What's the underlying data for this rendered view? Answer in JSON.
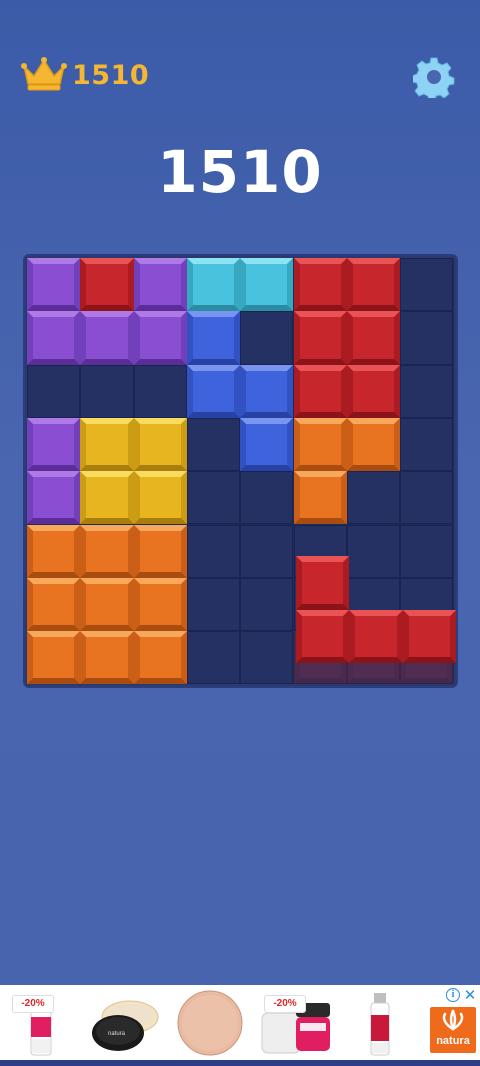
{
  "header": {
    "best_score": "1510",
    "crown_icon": "crown-icon",
    "settings_icon": "gear-icon"
  },
  "score": "1510",
  "board": {
    "rows": 8,
    "cols": 8,
    "palette": {
      "P": {
        "face": "#8a4ed3",
        "light": "#b07ae6",
        "dark": "#5a2d99",
        "side": "#7340bb"
      },
      "R": {
        "face": "#c8262d",
        "light": "#ea5356",
        "dark": "#8c1419",
        "side": "#aa1c22"
      },
      "C": {
        "face": "#48c2dd",
        "light": "#8ee3f2",
        "dark": "#2b8ba3",
        "side": "#37a8c2"
      },
      "B": {
        "face": "#3f63dd",
        "light": "#7a95f0",
        "dark": "#2741a5",
        "side": "#3352c2"
      },
      "Y": {
        "face": "#e6b520",
        "light": "#f7dc5f",
        "dark": "#a97e0e",
        "side": "#cc9c15"
      },
      "O": {
        "face": "#e87422",
        "light": "#f8a85a",
        "dark": "#a94c10",
        "side": "#cc5f18"
      }
    },
    "grid": [
      "PRPCCRR.",
      "PPPB.RR.",
      "...BBRR.",
      "PYY.BOO.",
      "PYY..O..",
      "OOO.....",
      "OOO.....",
      "OOO....."
    ],
    "floating_piece": {
      "color": "R",
      "cells": [
        [
          0,
          0
        ],
        [
          1,
          0
        ],
        [
          1,
          1
        ],
        [
          1,
          2
        ]
      ],
      "anchor_row": 5.6,
      "anchor_col": 5.05
    },
    "ghost_cells": [
      [
        7,
        5
      ],
      [
        7,
        6
      ],
      [
        7,
        7
      ]
    ]
  },
  "ad": {
    "items": [
      {
        "badge": "-20%",
        "kind": "bottle-pink"
      },
      {
        "badge": "",
        "kind": "jar-dark"
      },
      {
        "badge": "",
        "kind": "powder-circle"
      },
      {
        "badge": "-20%",
        "kind": "jar-pink"
      },
      {
        "badge": "",
        "kind": "bottle-red"
      }
    ],
    "brand": "natura",
    "info_icon": "i",
    "close_icon": "✕"
  }
}
